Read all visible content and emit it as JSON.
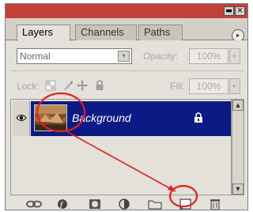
{
  "titlebar": {
    "minimize_glyph": "▬",
    "close_glyph": "✕"
  },
  "tabs": [
    {
      "label": "Layers",
      "active": true
    },
    {
      "label": "Channels",
      "active": false
    },
    {
      "label": "Paths",
      "active": false
    }
  ],
  "panel_menu_glyph": "▸",
  "blend_mode": {
    "value": "Normal",
    "arrow_glyph": "▾"
  },
  "opacity": {
    "label": "Opacity:",
    "value": "100%",
    "arrow_glyph": "▸"
  },
  "lock": {
    "label": "Lock:"
  },
  "fill": {
    "label": "Fill:",
    "value": "100%",
    "arrow_glyph": "▸"
  },
  "layers": [
    {
      "name": "Background",
      "visible": true,
      "locked": true,
      "selected": true
    }
  ],
  "scrollbar": {
    "up_glyph": "▲",
    "down_glyph": "▼"
  },
  "bottom_icons": [
    "link-layers-icon",
    "layer-style-icon",
    "layer-mask-icon",
    "adjustment-layer-icon",
    "new-group-icon",
    "new-layer-icon",
    "trash-icon"
  ],
  "colors": {
    "titlebar": "#c1413a",
    "selection": "#0c1a86",
    "annotation": "#e02020"
  }
}
